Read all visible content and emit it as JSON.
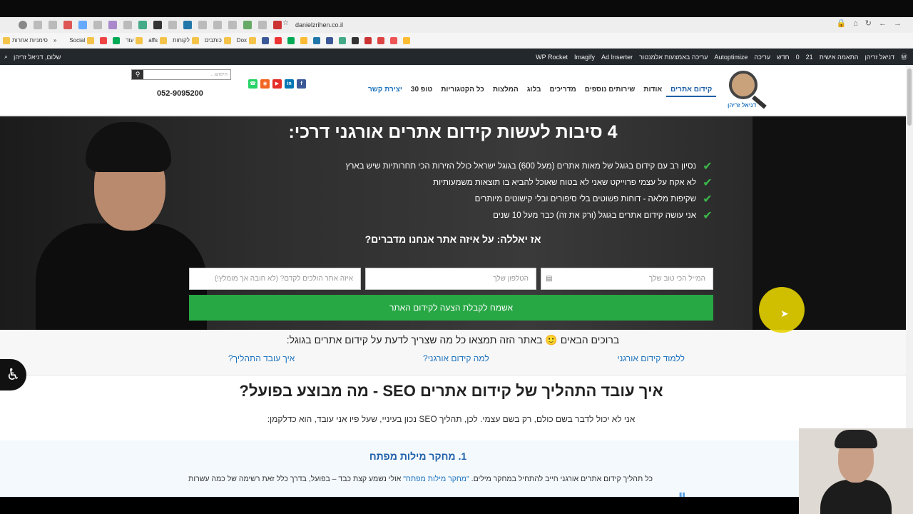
{
  "browser": {
    "url": "danielzrihen.co.il",
    "bookmarks": [
      "סימניות אחרות",
      "Social",
      "עוד",
      "affs",
      "לקוחות",
      "כותבים",
      "Dox"
    ]
  },
  "admin_bar": {
    "left": {
      "greeting": "שלום, דניאל זריהן"
    },
    "items": [
      "דניאל זריהן",
      "התאמה אישית",
      "21",
      "0",
      "חדש",
      "עריכה",
      "Autoptimize",
      "עריכה באמצעות אלמנטור",
      "Ad Inserter",
      "Imagify",
      "WP Rocket"
    ]
  },
  "header": {
    "logo_caption": "דניאל זריהן",
    "nav": [
      {
        "label": "קידום אתרים",
        "active": true
      },
      {
        "label": "אודות"
      },
      {
        "label": "שירותים נוספים"
      },
      {
        "label": "מדריכים"
      },
      {
        "label": "בלוג"
      },
      {
        "label": "המלצות"
      },
      {
        "label": "כל הקטגוריות"
      },
      {
        "label": "טופ 30"
      },
      {
        "label": "יצירת קשר",
        "contact": true
      }
    ],
    "search_placeholder": "חיפוש...",
    "phone": "052-9095200",
    "socials": [
      {
        "name": "facebook-icon",
        "glyph": "f",
        "color": "#3b5998"
      },
      {
        "name": "linkedin-icon",
        "glyph": "in",
        "color": "#0077b5"
      },
      {
        "name": "youtube-icon",
        "glyph": "▶",
        "color": "#e52d27"
      },
      {
        "name": "rss-icon",
        "glyph": "◉",
        "color": "#f26522"
      },
      {
        "name": "whatsapp-icon",
        "glyph": "☎",
        "color": "#25d366"
      }
    ]
  },
  "hero": {
    "title": "4 סיבות לעשות קידום אתרים אורגני דרכי:",
    "checklist": [
      "נסיון רב עם קידום בגוגל של מאות אתרים (מעל 600) בגוגל ישראל כולל הזירות הכי תחרותיות שיש בארץ",
      "לא אקח על עצמי פרוייקט שאני לא בטוח שאוכל להביא בו תוצאות משמעותיות",
      "שקיפות מלאה - דוחות פשוטים בלי סיפורים ובלי קישוטים מיותרים",
      "אני עושה קידום אתרים בגוגל (ורק את זה) כבר מעל 10 שנים"
    ],
    "subtitle": "אז יאללה: על איזה אתר אנחנו מדברים?",
    "fields": {
      "email_placeholder": "המייל הכי טוב שלך",
      "phone_placeholder": "הטלפון שלך",
      "site_placeholder": "איזה אתר הולכים לקדם? (לא חובה אך מומלץ!)"
    },
    "submit_label": "אשמח לקבלת הצעה לקידום האתר"
  },
  "welcome": {
    "line": "ברוכים הבאים 🙂 באתר הזה תמצאו כל מה שצריך לדעת על קידום אתרים בגוגל:",
    "links": [
      "איך עובד התהליך?",
      "למה קידום אורגני?",
      "ללמוד קידום אורגני"
    ]
  },
  "content": {
    "heading": "איך עובד התהליך של קידום אתרים SEO - מה מבוצע בפועל?",
    "intro": "אני לא יכול לדבר בשם כולם, רק בשם עצמי. לכן, תהליך SEO נכון בעיניי, שעל פיו אני עובד, הוא כדלקמן:",
    "step1_title": "1. מחקר מילות מפתח",
    "step1_text_a": "כל תהליך קידום אתרים אורגני חייב להתחיל במחקר מילים. ",
    "step1_quote": "\"מחקר מילות מפתח\"",
    "step1_text_b": " אולי נשמע קצת כבד – בפועל, בדרך כלל זאת רשימה של כמה עשרות"
  },
  "colors": {
    "accent": "#1e73be",
    "submit": "#28a745",
    "check": "#3cb94a",
    "admin_bar": "#23282d"
  }
}
